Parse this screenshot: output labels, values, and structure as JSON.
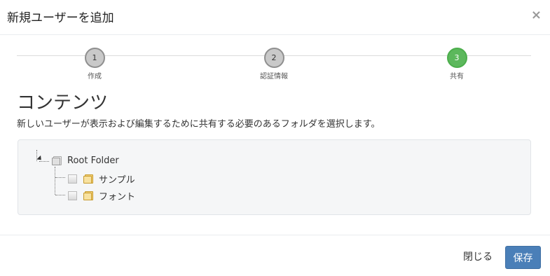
{
  "modal": {
    "title": "新規ユーザーを追加",
    "close_icon": "×"
  },
  "stepper": {
    "steps": [
      {
        "number": "1",
        "label": "作成",
        "state": "default"
      },
      {
        "number": "2",
        "label": "認証情報",
        "state": "default"
      },
      {
        "number": "3",
        "label": "共有",
        "state": "active"
      }
    ],
    "active_color": "#5cb85c"
  },
  "content": {
    "title": "コンテンツ",
    "description": "新しいユーザーが表示および編集するために共有する必要のあるフォルダを選択します。"
  },
  "tree": {
    "root": {
      "label": "Root Folder",
      "icon": "folder-icon"
    },
    "children": [
      {
        "label": "サンプル",
        "checked": false,
        "icon": "folder-icon"
      },
      {
        "label": "フォント",
        "checked": false,
        "icon": "folder-icon"
      }
    ]
  },
  "footer": {
    "close_label": "閉じる",
    "save_label": "保存",
    "save_color": "#4a7fb8"
  }
}
